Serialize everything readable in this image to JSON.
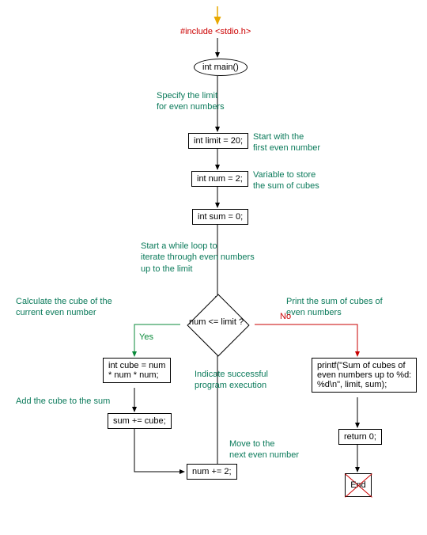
{
  "include": "#include <stdio.h>",
  "main": "int main()",
  "ann_limit": "Specify the limit\nfor even numbers",
  "limit_decl": "int limit = 20;",
  "ann_first": "Start with the\nfirst even number",
  "num_decl": "int num = 2;",
  "ann_var": "Variable to store\nthe sum of cubes",
  "sum_decl": "int sum = 0;",
  "ann_loop": "Start a while loop to\niterate through even numbers\nup to the limit",
  "cond": "num <= limit ?",
  "ann_cube": "Calculate the cube of the\ncurrent even number",
  "cube_decl": "int cube = num\n* num * num;",
  "ann_add": "Add the cube to the sum",
  "sum_add": "sum += cube;",
  "ann_next": "Move to the\nnext even number",
  "num_inc": "num += 2;",
  "ann_print": "Print the sum of cubes of\neven numbers",
  "printf": "printf(\"Sum of cubes of\neven numbers up to %d:\n%d\\n\", limit, sum);",
  "ann_exec": "Indicate successful\nprogram execution",
  "return": "return 0;",
  "end": "End",
  "yes": "Yes",
  "no": "No"
}
